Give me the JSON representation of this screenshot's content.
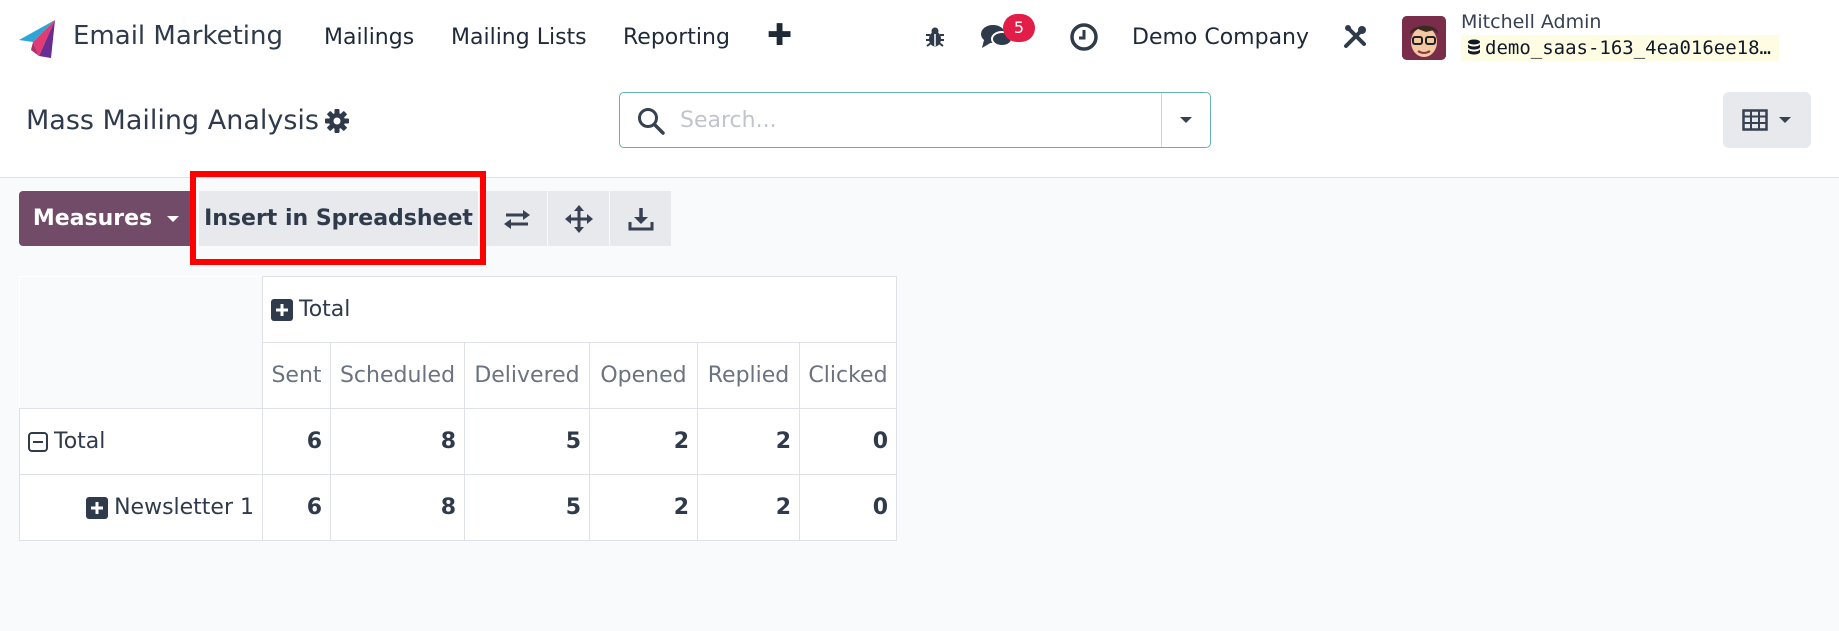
{
  "navbar": {
    "app_name": "Email Marketing",
    "menus": [
      "Mailings",
      "Mailing Lists",
      "Reporting"
    ],
    "new_icon": "plus-icon",
    "messages_badge": "5",
    "company": "Demo Company",
    "user": {
      "name": "Mitchell Admin",
      "database": "demo_saas-163_4ea016ee18…"
    },
    "icons": [
      "debug-bug-icon",
      "chat-bubbles-icon",
      "activity-clock-icon",
      "settings-tools-icon",
      "database-icon"
    ]
  },
  "control_panel": {
    "title": "Mass Mailing Analysis",
    "search_placeholder": "Search...",
    "view_switcher_icon": "spreadsheet-grid-icon"
  },
  "toolbar": {
    "measures_label": "Measures",
    "insert_label": "Insert in Spreadsheet",
    "tool_icons": [
      "flip-axis-icon",
      "expand-all-icon",
      "download-icon"
    ],
    "highlight_color": "#ff0000"
  },
  "pivot": {
    "column_group": "Total",
    "measures": [
      "Sent",
      "Scheduled",
      "Delivered",
      "Opened",
      "Replied",
      "Clicked"
    ],
    "rows": [
      {
        "label": "Total",
        "values": [
          "6",
          "8",
          "5",
          "2",
          "2",
          "0"
        ]
      },
      {
        "label": "Newsletter 1",
        "values": [
          "6",
          "8",
          "5",
          "2",
          "2",
          "0"
        ]
      }
    ]
  },
  "colors": {
    "brand": "#714b67",
    "badge": "#e11d48",
    "search_border": "#66b2b0"
  }
}
